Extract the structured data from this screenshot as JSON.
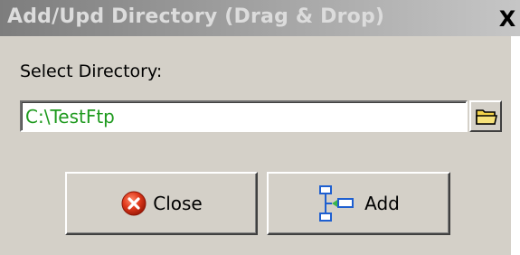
{
  "window": {
    "title": "Add/Upd Directory (Drag & Drop)",
    "close_glyph": "X"
  },
  "form": {
    "directory_label": "Select Directory:",
    "directory_value": "C:\\TestFtp",
    "browse_icon": "folder-icon"
  },
  "buttons": {
    "close_label": "Close",
    "close_icon": "error-circle-icon",
    "add_label": "Add",
    "add_icon": "tree-add-icon"
  },
  "colors": {
    "path_text": "#1f9a1f",
    "dialog_bg": "#d4d0c8"
  }
}
